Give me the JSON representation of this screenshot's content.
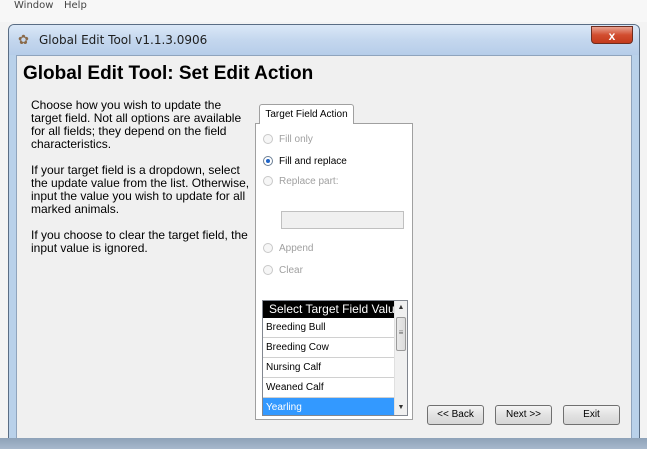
{
  "background_menu": {
    "items": [
      "Window",
      "Help"
    ]
  },
  "window": {
    "title": "Global Edit Tool v1.1.3.0906",
    "close_symbol": "x",
    "icon": "app-icon"
  },
  "heading": "Global Edit Tool:  Set Edit Action",
  "instructions": [
    "Choose how you wish to update the target field.  Not all options are available for all fields; they depend on the field characteristics.",
    "If your target field is a dropdown, select the update value from the list. Otherwise, input the value you wish to update for all marked animals.",
    "If you choose to clear the target field, the input value is ignored."
  ],
  "tab": {
    "label": "Target Field Action"
  },
  "options": {
    "fill_only": {
      "label": "Fill only",
      "selected": false,
      "enabled": false
    },
    "fill_replace": {
      "label": "Fill and replace",
      "selected": true,
      "enabled": true
    },
    "replace_part": {
      "label": "Replace part:",
      "selected": false,
      "enabled": false
    },
    "replace_part_value": "",
    "append": {
      "label": "Append",
      "selected": false,
      "enabled": false
    },
    "clear": {
      "label": "Clear",
      "selected": false,
      "enabled": false
    }
  },
  "value_list": {
    "header": "Select Target Field Value:",
    "items": [
      "Breeding Bull",
      "Breeding Cow",
      "Nursing Calf",
      "Weaned Calf",
      "Yearling"
    ],
    "selected": "Yearling"
  },
  "buttons": {
    "back": "<< Back",
    "next": "Next >>",
    "exit": "Exit"
  },
  "colors": {
    "selection": "#3399ff",
    "list_header": "#000000",
    "window_frame": "#b9d1ea"
  }
}
